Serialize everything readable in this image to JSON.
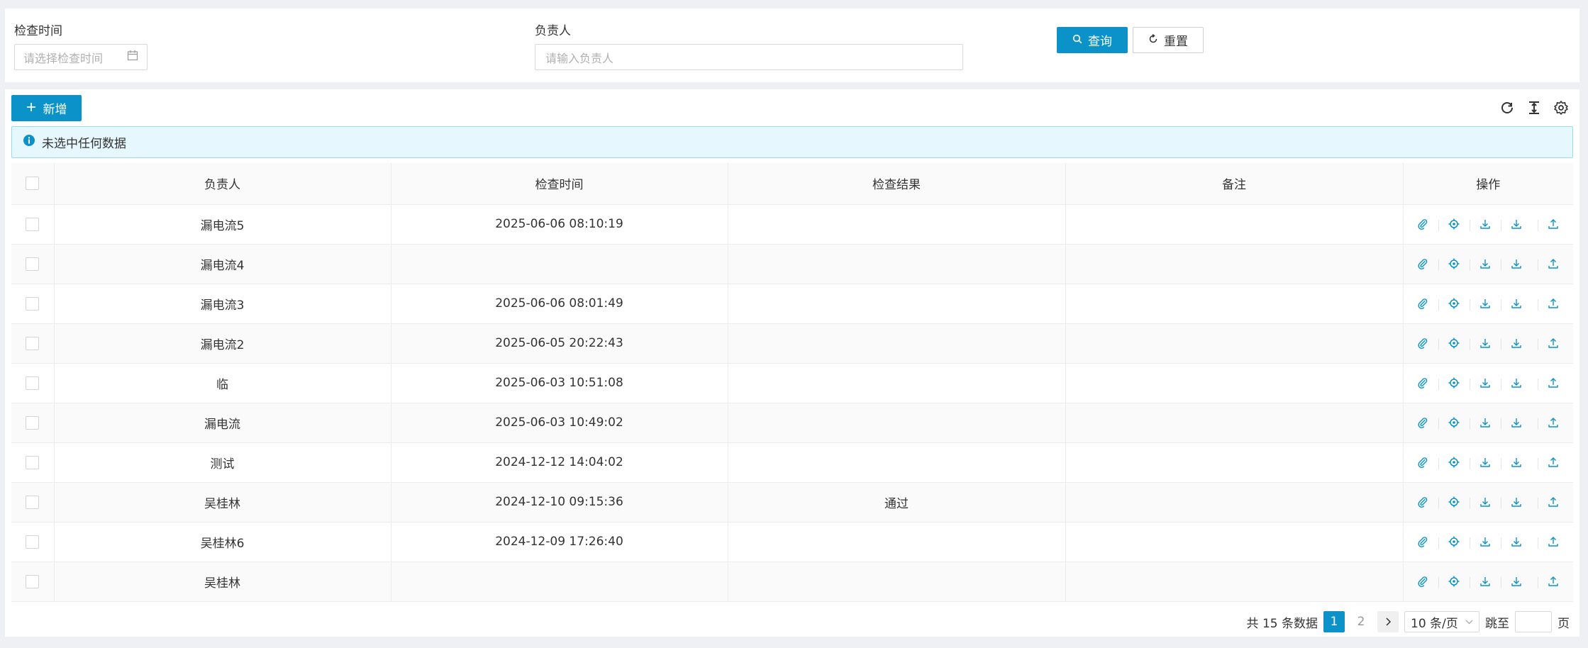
{
  "search": {
    "check_time_label": "检查时间",
    "check_time_placeholder": "请选择检查时间",
    "owner_label": "负责人",
    "owner_placeholder": "请输入负责人",
    "query_label": "查询",
    "reset_label": "重置"
  },
  "toolbar": {
    "add_label": "新增"
  },
  "alert": {
    "text": "未选中任何数据"
  },
  "table": {
    "columns": [
      "负责人",
      "检查时间",
      "检查结果",
      "备注",
      "操作"
    ],
    "rows": [
      {
        "owner": "漏电流5",
        "time": "2025-06-06 08:10:19",
        "result": "",
        "note": ""
      },
      {
        "owner": "漏电流4",
        "time": "",
        "result": "",
        "note": ""
      },
      {
        "owner": "漏电流3",
        "time": "2025-06-06 08:01:49",
        "result": "",
        "note": ""
      },
      {
        "owner": "漏电流2",
        "time": "2025-06-05 20:22:43",
        "result": "",
        "note": ""
      },
      {
        "owner": "临",
        "time": "2025-06-03 10:51:08",
        "result": "",
        "note": ""
      },
      {
        "owner": "漏电流",
        "time": "2025-06-03 10:49:02",
        "result": "",
        "note": ""
      },
      {
        "owner": "测试",
        "time": "2024-12-12 14:04:02",
        "result": "",
        "note": ""
      },
      {
        "owner": "吴桂林",
        "time": "2024-12-10 09:15:36",
        "result": "通过",
        "note": ""
      },
      {
        "owner": "吴桂林6",
        "time": "2024-12-09 17:26:40",
        "result": "",
        "note": ""
      },
      {
        "owner": "吴桂林",
        "time": "",
        "result": "",
        "note": ""
      }
    ],
    "row_actions": [
      "paperclip-icon",
      "target-icon",
      "download-icon",
      "download-icon",
      "upload-icon"
    ]
  },
  "pagination": {
    "total_text": "共 15 条数据",
    "pages": [
      "1",
      "2"
    ],
    "current_page": "1",
    "page_size": "10 条/页",
    "jump_label": "跳至",
    "page_suffix": "页"
  },
  "colors": {
    "primary": "#0b93c9",
    "alert_bg": "#e6f7fd",
    "alert_border": "#9dd8f0"
  }
}
